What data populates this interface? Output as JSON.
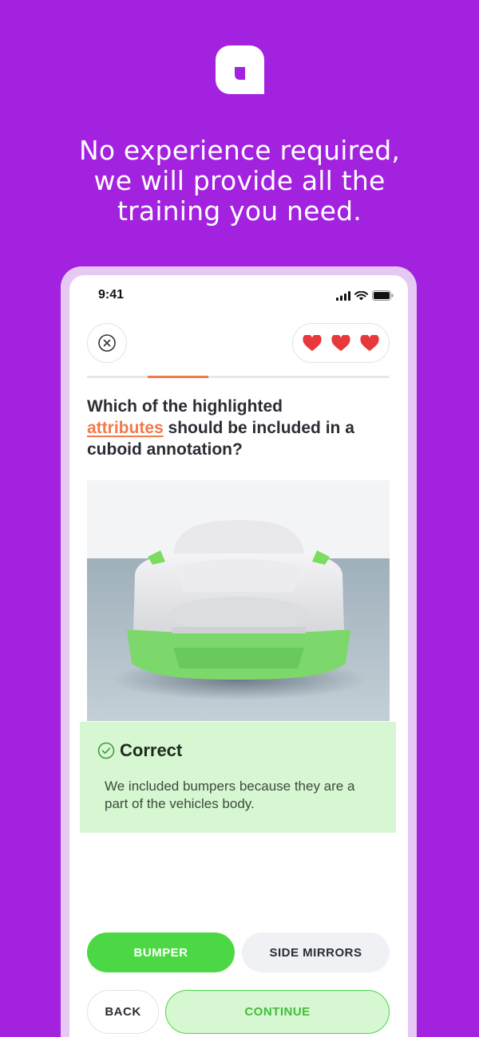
{
  "brand": {
    "logo_icon": "brand-logo-icon",
    "background_color": "#a322e0"
  },
  "headline": {
    "line1": "No experience required,",
    "line2": "we will provide all the",
    "line3": "training you need."
  },
  "phone": {
    "status": {
      "time": "9:41",
      "icons": [
        "cellular-signal-icon",
        "wifi-icon",
        "battery-icon"
      ]
    },
    "close_icon": "close-circle-icon",
    "lives": {
      "count": 3,
      "icon": "heart-icon",
      "color": "#e8383b"
    },
    "progress": {
      "value": 0.2,
      "color": "#f07a4a"
    },
    "question": {
      "before": "Which of the highlighted",
      "highlight": "attributes",
      "after": "should be included in a cuboid annotation?"
    },
    "feedback": {
      "icon": "check-circle-icon",
      "title": "Correct",
      "text": "We included bumpers because they are a part of the vehicles body.",
      "background": "#d7f6d2"
    },
    "options": {
      "bumper_label": "BUMPER",
      "side_mirrors_label": "SIDE MIRRORS",
      "selected_color": "#4cd845"
    },
    "nav": {
      "back_label": "BACK",
      "continue_label": "CONTINUE"
    }
  }
}
